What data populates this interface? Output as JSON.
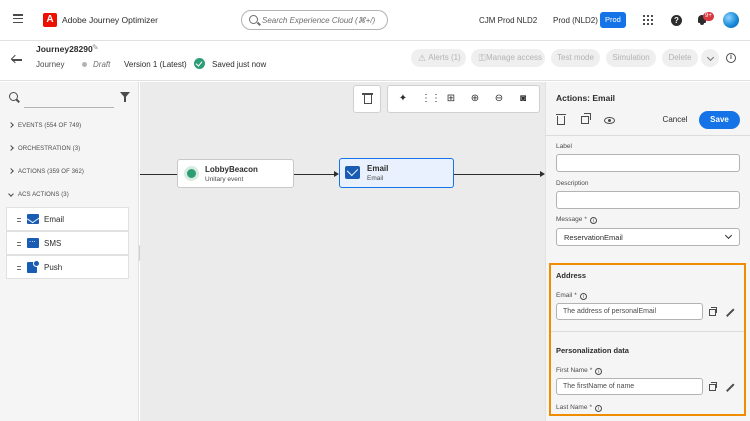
{
  "topbar": {
    "app_title": "Adobe Journey Optimizer",
    "search_placeholder": "Search Experience Cloud (⌘+/)",
    "org": "CJM Prod NLD2",
    "sandbox": "Prod (NLD2)",
    "env_badge": "Prod",
    "notification_count": "9+",
    "help_glyph": "?"
  },
  "journey": {
    "name": "Journey28290",
    "type": "Journey",
    "status": "Draft",
    "version": "Version 1 (Latest)",
    "saved": "Saved just now",
    "buttons": {
      "alerts": "Alerts (1)",
      "manage_access": "Manage access",
      "test_mode": "Test mode",
      "simulation": "Simulation",
      "delete": "Delete"
    }
  },
  "palette": {
    "categories": [
      {
        "label": "EVENTS (554 OF 749)"
      },
      {
        "label": "ORCHESTRATION (3)"
      },
      {
        "label": "ACTIONS (359 OF 362)"
      },
      {
        "label": "ACS ACTIONS (3)"
      }
    ],
    "acs_actions": [
      {
        "label": "Email",
        "icon": "email-icon"
      },
      {
        "label": "SMS",
        "icon": "sms-icon"
      },
      {
        "label": "Push",
        "icon": "push-icon"
      }
    ]
  },
  "canvas": {
    "nodes": [
      {
        "title": "LobbyBeacon",
        "subtitle": "Unitary event",
        "icon": "globe-icon"
      },
      {
        "title": "Email",
        "subtitle": "Email",
        "icon": "mail-icon"
      }
    ]
  },
  "panel": {
    "title": "Actions: Email",
    "cancel": "Cancel",
    "save": "Save",
    "label_field": {
      "label": "Label",
      "value": ""
    },
    "description_field": {
      "label": "Description",
      "value": ""
    },
    "message_field": {
      "label": "Message",
      "value": "ReservationEmail"
    },
    "address_section": {
      "title": "Address",
      "email_label": "Email",
      "email_value": "The address of personalEmail"
    },
    "personalization_section": {
      "title": "Personalization data",
      "first_name_label": "First Name",
      "first_name_value": "The firstName of name",
      "last_name_label": "Last Name"
    },
    "required_marker": "*",
    "info_glyph": "i"
  },
  "colors": {
    "accent": "#1473e6",
    "brand": "#eb1000",
    "highlight": "#f08c00",
    "success": "#2d9d78"
  }
}
